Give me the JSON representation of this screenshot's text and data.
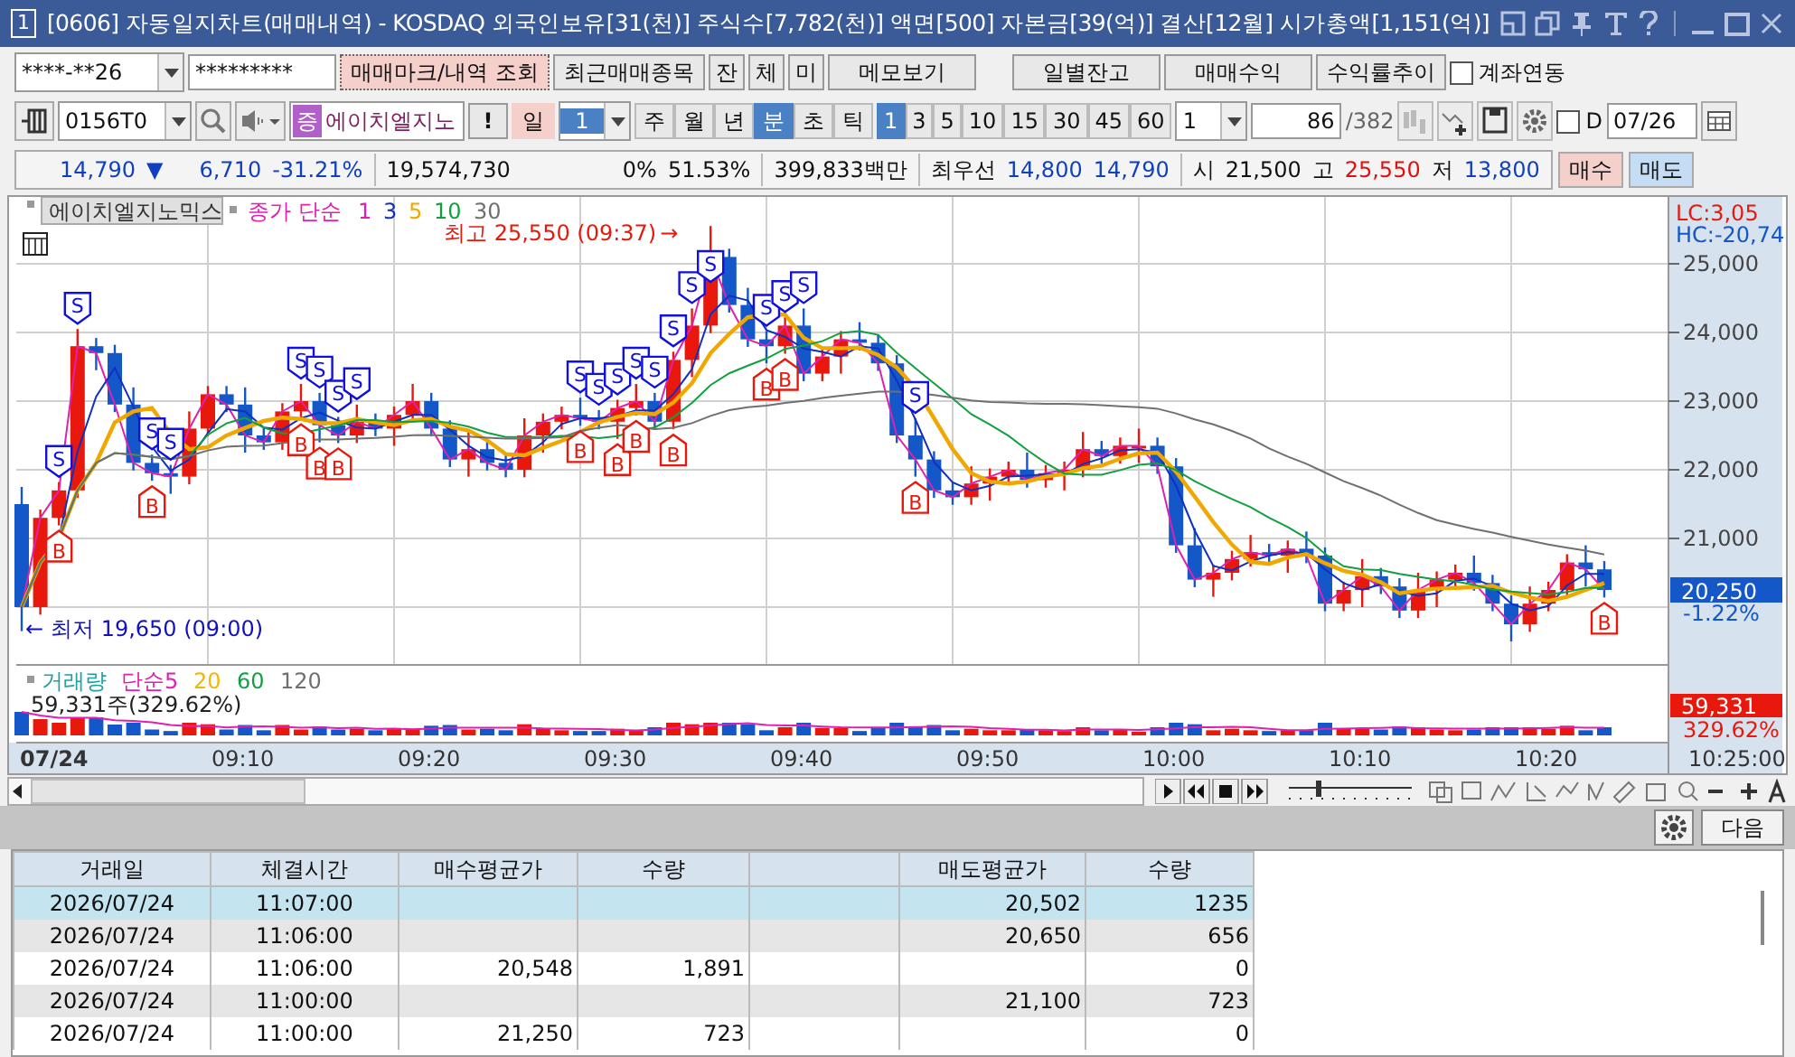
{
  "window": {
    "badge": "1",
    "title": "[0606] 자동일지차트(매매내역) - KOSDAQ 외국인보유[31(천)] 주식수[7,782(천)] 액면[500] 자본금[39(억)] 결산[12월] 시가총액[1,151(억)]"
  },
  "toolbar1": {
    "account": "****-**26",
    "password": "*********",
    "buttons": [
      {
        "label": "매매마크/내역 조회",
        "kind": "accent"
      },
      {
        "label": "최근매매종목",
        "kind": "plain"
      },
      {
        "label": "잔",
        "kind": "small"
      },
      {
        "label": "체",
        "kind": "small"
      },
      {
        "label": "미",
        "kind": "small"
      },
      {
        "label": "메모보기",
        "kind": "wide"
      },
      {
        "label": "일별잔고",
        "kind": "wide"
      },
      {
        "label": "매매수익",
        "kind": "wide"
      },
      {
        "label": "수익률추이",
        "kind": "plain"
      }
    ],
    "link_checkbox": {
      "label": "계좌연동",
      "checked": false
    }
  },
  "toolbar2": {
    "code": "0156T0",
    "market_badge": "증",
    "stock_name": "에이치엘지노",
    "alert": "!",
    "period": "일",
    "period_count": "1",
    "units": [
      {
        "label": "주",
        "selected": false
      },
      {
        "label": "월",
        "selected": false
      },
      {
        "label": "년",
        "selected": false
      },
      {
        "label": "분",
        "selected": true
      },
      {
        "label": "초",
        "selected": false
      },
      {
        "label": "틱",
        "selected": false
      }
    ],
    "intervals": [
      {
        "label": "1",
        "selected": true
      },
      {
        "label": "3",
        "selected": false
      },
      {
        "label": "5",
        "selected": false
      },
      {
        "label": "10",
        "selected": false
      },
      {
        "label": "15",
        "selected": false
      },
      {
        "label": "30",
        "selected": false
      },
      {
        "label": "45",
        "selected": false
      },
      {
        "label": "60",
        "selected": false
      }
    ],
    "step": "1",
    "count": "86",
    "total": "/382",
    "d_checkbox": {
      "label": "D",
      "checked": false
    },
    "date": "07/26"
  },
  "quote": {
    "price": "14,790",
    "direction": "▼",
    "change": "6,710",
    "change_rate": "-31.21%",
    "volume": "19,574,730",
    "pct_a": "0%",
    "pct_b": "51.53%",
    "amount": "399,833백만",
    "best_label": "최우선",
    "ask": "14,800",
    "bid": "14,790",
    "open_label": "시",
    "open": "21,500",
    "high_label": "고",
    "high": "25,550",
    "low_label": "저",
    "low": "13,800",
    "buy": "매수",
    "sell": "매도"
  },
  "chart": {
    "stock_tab": "에이치엘지노믹스",
    "legend": [
      {
        "text": "종가 단순",
        "color": "#e020b0"
      },
      {
        "text": "1",
        "color": "#e020b0"
      },
      {
        "text": "3",
        "color": "#1030c0"
      },
      {
        "text": "5",
        "color": "#f0a800"
      },
      {
        "text": "10",
        "color": "#10a040"
      },
      {
        "text": "30",
        "color": "#707070"
      }
    ],
    "volume_legend": [
      {
        "text": "거래량",
        "color": "#20a0a0"
      },
      {
        "text": "단순",
        "color": "#e020b0"
      },
      {
        "text": "5",
        "color": "#e020b0"
      },
      {
        "text": "20",
        "color": "#f0b800"
      },
      {
        "text": "60",
        "color": "#10a040"
      },
      {
        "text": "120",
        "color": "#707070"
      }
    ],
    "volume_reading": "59,331주(329.62%)",
    "lc": "LC:3,05",
    "hc": "HC:-20,74",
    "y_axis": [
      "25,000",
      "24,000",
      "23,000",
      "22,000",
      "21,000"
    ],
    "x_axis": [
      "07/24",
      "09:10",
      "09:20",
      "09:30",
      "09:40",
      "09:50",
      "10:00",
      "10:10",
      "10:20"
    ],
    "end_time": "10:25:00",
    "last_price": "20,250",
    "last_rate": "-1.22%",
    "last_volume": "59,331",
    "last_volume_rate": "329.62%",
    "high_note": "최고 25,550 (09:37)",
    "high_arrow": "→",
    "low_arrow": "←",
    "low_note": "최저 19,650 (09:00)",
    "trade_marks": [
      {
        "kind": "sell",
        "text": "S"
      },
      {
        "kind": "sell",
        "text": "S"
      },
      {
        "kind": "buy",
        "text": "B"
      },
      {
        "kind": "sell",
        "text": "S"
      },
      {
        "kind": "sell",
        "text": "S"
      },
      {
        "kind": "buy",
        "text": "B"
      },
      {
        "kind": "sell",
        "text": "S"
      },
      {
        "kind": "sell",
        "text": "S"
      },
      {
        "kind": "buy",
        "text": "B"
      },
      {
        "kind": "sell",
        "text": "S"
      },
      {
        "kind": "sell",
        "text": "S"
      },
      {
        "kind": "buy",
        "text": "B"
      },
      {
        "kind": "buy",
        "text": "B"
      },
      {
        "kind": "sell",
        "text": "S"
      },
      {
        "kind": "sell",
        "text": "S"
      },
      {
        "kind": "buy",
        "text": "B"
      },
      {
        "kind": "sell",
        "text": "S"
      },
      {
        "kind": "sell",
        "text": "S"
      },
      {
        "kind": "buy",
        "text": "B"
      },
      {
        "kind": "buy",
        "text": "B"
      },
      {
        "kind": "sell",
        "text": "S"
      },
      {
        "kind": "sell",
        "text": "S"
      },
      {
        "kind": "buy",
        "text": "B"
      },
      {
        "kind": "sell",
        "text": "S"
      },
      {
        "kind": "sell",
        "text": "S"
      },
      {
        "kind": "sell",
        "text": "S"
      },
      {
        "kind": "sell",
        "text": "S"
      },
      {
        "kind": "sell",
        "text": "S"
      },
      {
        "kind": "buy",
        "text": "B"
      },
      {
        "kind": "buy",
        "text": "B"
      },
      {
        "kind": "sell",
        "text": "S"
      },
      {
        "kind": "buy",
        "text": "B"
      },
      {
        "kind": "buy",
        "text": "B"
      }
    ]
  },
  "bottom": {
    "zoom": {
      "level": 0.25
    },
    "next_button": "다음"
  },
  "table": {
    "columns": [
      "거래일",
      "체결시간",
      "매수평균가",
      "수량",
      "",
      "매도평균가",
      "수량"
    ],
    "rows": [
      {
        "selected": true,
        "cells": [
          "2026/07/24",
          "11:07:00",
          "",
          "",
          "",
          "20,502",
          "1235"
        ]
      },
      {
        "selected": false,
        "cells": [
          "2026/07/24",
          "11:06:00",
          "",
          "",
          "",
          "20,650",
          "656"
        ]
      },
      {
        "selected": false,
        "cells": [
          "2026/07/24",
          "11:06:00",
          "20,548",
          "1,891",
          "",
          "",
          "0"
        ]
      },
      {
        "selected": false,
        "cells": [
          "2026/07/24",
          "11:00:00",
          "",
          "",
          "",
          "21,100",
          "723"
        ]
      },
      {
        "selected": false,
        "cells": [
          "2026/07/24",
          "11:00:00",
          "21,250",
          "723",
          "",
          "",
          "0"
        ]
      }
    ]
  }
}
